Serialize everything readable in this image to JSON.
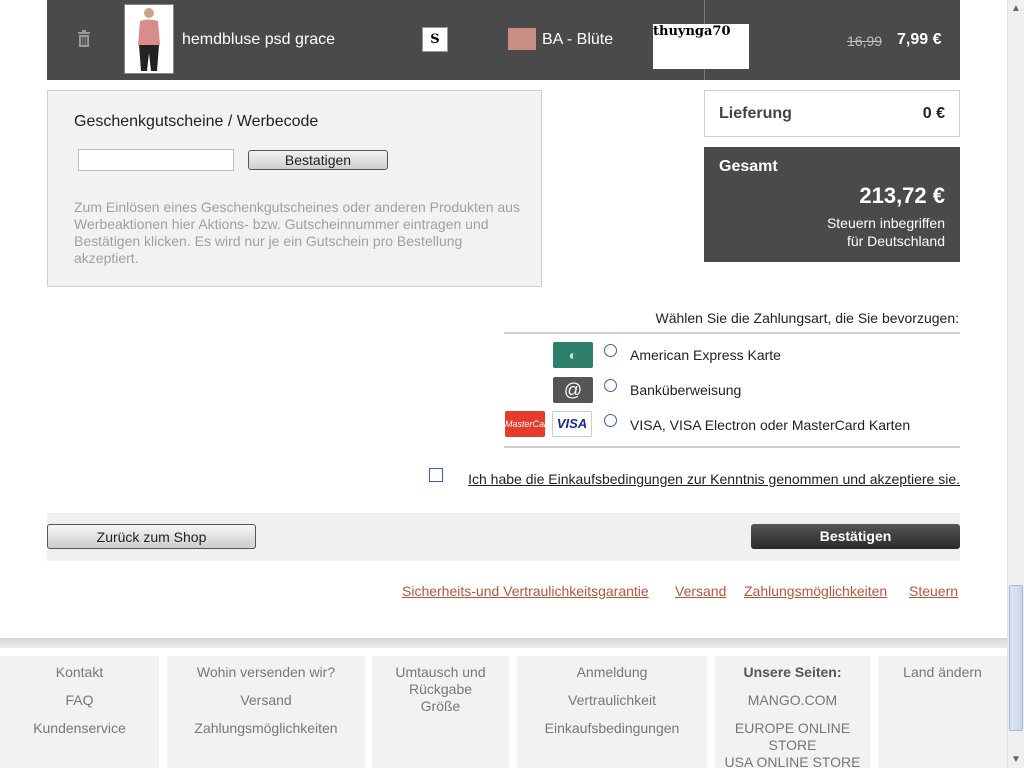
{
  "cart_item": {
    "product_name": "hemdbluse psd grace",
    "size": "S",
    "color_name": "BA - Blüte",
    "color_hex": "#c98f87",
    "user_label": "thuynga70",
    "old_price": "16,99",
    "new_price": "7,99 €"
  },
  "coupon": {
    "title": "Geschenkgutscheine / Werbecode",
    "input_value": "",
    "confirm_label": "Bestatigen",
    "help_text": "Zum Einlösen eines Geschenkgutscheines oder anderen Produkten aus Werbeaktionen hier Aktions- bzw. Gutscheinnummer eintragen und Bestätigen klicken. Es wird nur je ein Gutschein pro Bestellung akzeptiert."
  },
  "delivery": {
    "label": "Lieferung",
    "value": "0 €"
  },
  "total": {
    "label": "Gesamt",
    "value": "213,72 €",
    "tax_note_line1": "Steuern inbegriffen",
    "tax_note_line2": "für Deutschland"
  },
  "payment": {
    "title": "Wählen Sie die Zahlungsart, die Sie bevorzugen:",
    "options": [
      {
        "label": "American Express Karte",
        "icon": "amex-card-icon"
      },
      {
        "label": "Banküberweisung",
        "icon": "at-sign-icon"
      },
      {
        "label": "VISA, VISA Electron oder MasterCard Karten",
        "icon": "visa-mastercard-icon"
      }
    ],
    "icon_text": {
      "mastercard": "MasterCard",
      "visa": "VISA",
      "at": "@",
      "amex": "◐"
    }
  },
  "terms": {
    "label": "Ich habe die Einkaufsbedingungen zur Kenntnis genommen und akzeptiere sie."
  },
  "actions": {
    "back_label": "Zurück zum Shop",
    "confirm_label": "Bestätigen"
  },
  "info_links": [
    "Sicherheits-und Vertraulichkeitsgarantie",
    "Versand",
    "Zahlungsmöglichkeiten",
    "Steuern"
  ],
  "footer": {
    "col1": [
      "Kontakt",
      "FAQ",
      "Kundenservice"
    ],
    "col2": [
      "Wohin versenden wir?",
      "Versand",
      "Zahlungsmöglichkeiten"
    ],
    "col3": [
      "Umtausch und Rückgabe",
      "Größe"
    ],
    "col4": [
      "Anmeldung",
      "Vertraulichkeit",
      "Einkaufsbedingungen"
    ],
    "col5_heading": "Unsere Seiten:",
    "col5": [
      "MANGO.COM",
      "EUROPE ONLINE STORE",
      "USA ONLINE STORE"
    ],
    "col6": [
      "Land ändern"
    ]
  },
  "colors": {
    "dark_panel": "#4a4a4a",
    "link": "#b0573f",
    "light_panel": "#f2f2f2"
  }
}
